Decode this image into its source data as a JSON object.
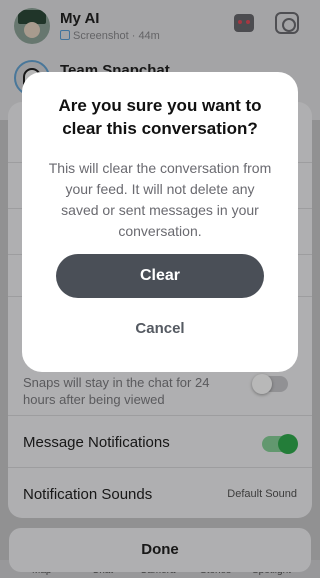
{
  "chats": [
    {
      "name": "My AI",
      "status": "Screenshot",
      "time": "44m"
    },
    {
      "name": "Team Snapchat"
    }
  ],
  "settings": {
    "keep_desc": "Snaps will stay in the chat for 24 hours after being viewed",
    "notifications_label": "Message Notifications",
    "notifications_on": true,
    "sounds_label": "Notification Sounds",
    "sounds_value": "Default Sound",
    "keep_snaps_on": false
  },
  "done_label": "Done",
  "nav": [
    "Map",
    "Chat",
    "Camera",
    "Stories",
    "Spotlight"
  ],
  "dialog": {
    "title": "Are you sure you want to clear this conversation?",
    "body": "This will clear the conversation from your feed. It will not delete any saved or sent messages in your conversation.",
    "confirm": "Clear",
    "cancel": "Cancel"
  },
  "colors": {
    "toggle_on": "#31ad4f",
    "primary_button": "#4a4f57"
  }
}
